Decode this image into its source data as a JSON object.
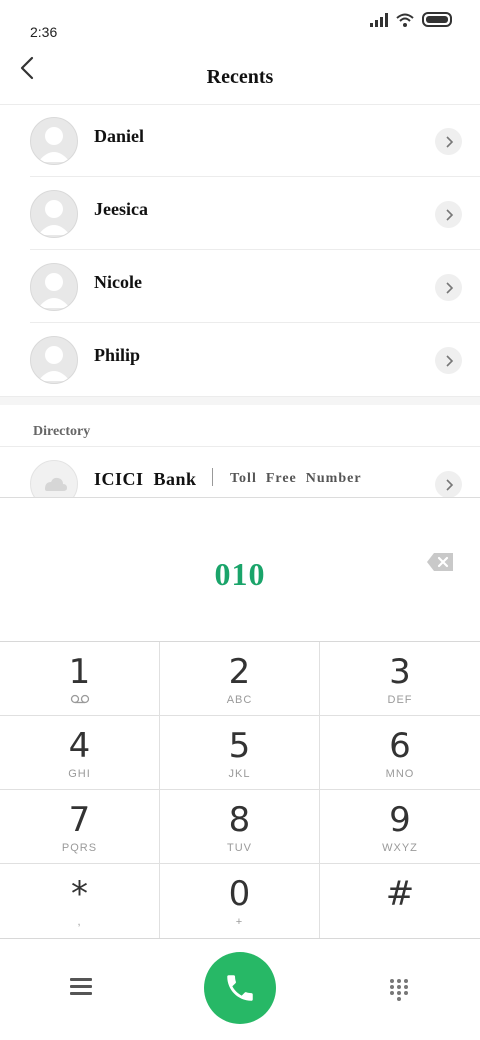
{
  "status_bar": {
    "time": "2:36",
    "icons": [
      "signal-icon",
      "wifi-icon",
      "battery-icon"
    ]
  },
  "header": {
    "back_icon": "chevron-left-icon",
    "title": "Recents"
  },
  "recents": [
    {
      "name": "Daniel"
    },
    {
      "name": "Jeesica"
    },
    {
      "name": "Nicole"
    },
    {
      "name": "Philip"
    }
  ],
  "directory": {
    "section_title": "Directory",
    "entry": {
      "name": "ICICI  Bank",
      "label": "Toll  Free  Number"
    }
  },
  "dialer": {
    "number": "010",
    "number_color": "#1aa46a"
  },
  "keypad": [
    {
      "digit": "1",
      "letters": ""
    },
    {
      "digit": "2",
      "letters": "ABC"
    },
    {
      "digit": "3",
      "letters": "DEF"
    },
    {
      "digit": "4",
      "letters": "GHI"
    },
    {
      "digit": "5",
      "letters": "JKL"
    },
    {
      "digit": "6",
      "letters": "MNO"
    },
    {
      "digit": "7",
      "letters": "PQRS"
    },
    {
      "digit": "8",
      "letters": "TUV"
    },
    {
      "digit": "9",
      "letters": "WXYZ"
    },
    {
      "digit": "*",
      "letters": ","
    },
    {
      "digit": "0",
      "letters": "+"
    },
    {
      "digit": "#",
      "letters": ""
    }
  ],
  "bottom_bar": {
    "menu_icon": "menu-icon",
    "call_icon": "phone-icon",
    "dialpad_icon": "dialpad-icon",
    "call_color": "#27b866"
  }
}
